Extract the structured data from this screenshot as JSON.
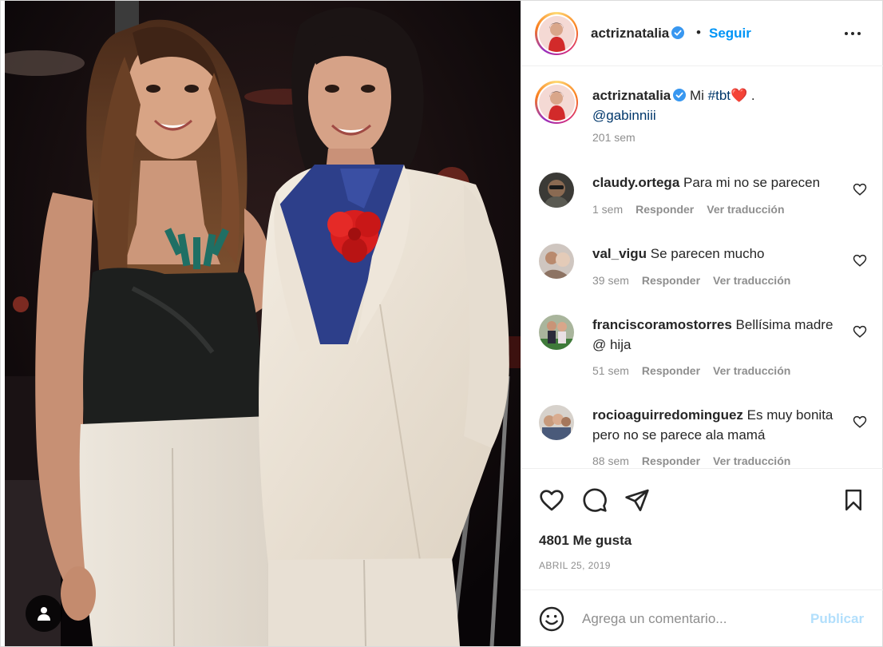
{
  "post": {
    "username": "actriznatalia",
    "verified": true,
    "separator": "•",
    "follow_label": "Seguir",
    "more_icon": "more-horizontal-icon",
    "caption": {
      "username": "actriznatalia",
      "text_pre": "Mi ",
      "hashtag": "#tbt",
      "emoji": "❤️",
      "text_post": " .",
      "mention": "@gabinniii",
      "time": "201 sem"
    },
    "comments": [
      {
        "username": "claudy.ortega",
        "text": "Para mi no se parecen",
        "time": "1 sem",
        "reply": "Responder",
        "translate": "Ver traducción"
      },
      {
        "username": "val_vigu",
        "text": "Se parecen mucho",
        "time": "39 sem",
        "reply": "Responder",
        "translate": "Ver traducción"
      },
      {
        "username": "franciscoramostorres",
        "text": "Bellísima madre @ hija",
        "time": "51 sem",
        "reply": "Responder",
        "translate": "Ver traducción"
      },
      {
        "username": "rocioaguirredominguez",
        "text": "Es muy bonita pero no se parece ala mamá",
        "time": "88 sem",
        "reply": "Responder",
        "translate": "Ver traducción"
      }
    ],
    "likes": "4801 Me gusta",
    "date": "ABRIL 25, 2019",
    "comment_placeholder": "Agrega un comentario...",
    "publish_label": "Publicar"
  },
  "colors": {
    "link_blue": "#0095f6",
    "publish_disabled": "#b2dffc",
    "muted": "#8e8e8e",
    "text": "#262626"
  }
}
